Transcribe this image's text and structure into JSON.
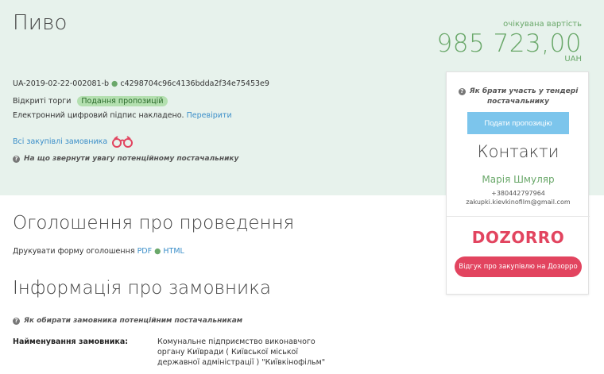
{
  "tender": {
    "title": "Пиво",
    "expected_label": "очікувана вартість",
    "price": "985 723,00",
    "currency": "UAH",
    "id": "UA-2019-02-22-002081-b",
    "hash": "c4298704c96c4136bdda2f34e75453e9",
    "procedure": "Відкриті торги",
    "status_badge": "Подання пропозицій",
    "signature_text": "Електронний цифровий підпис накладено.",
    "verify_link": "Перевірити",
    "all_purchases_link": "Всі закупівлі замовника",
    "attention_hint": "На що звернути увагу потенційному постачальнику"
  },
  "panel": {
    "participate_hint": "Як брати участь у тендері постачальнику",
    "submit_button": "Подати пропозицію",
    "contacts_title": "Контакти",
    "contact_name": "Марія Шмуляр",
    "contact_phone": "+380442797964",
    "contact_email": "zakupki.kievkinofilm@gmail.com",
    "dozorro_logo": "DOZORRO",
    "dozorro_button": "Відгук про закупівлю на Дозорро"
  },
  "announcement": {
    "heading": "Оголошення про проведення",
    "print_text": "Друкувати форму оголошення",
    "pdf_link": "PDF",
    "html_link": "HTML"
  },
  "customer": {
    "heading": "Інформація про замовника",
    "hint": "Як обирати замовника потенційним постачальникам",
    "name_label": "Найменування замовника:",
    "name_value": "Комунальне підприємство виконавчого органу Київради ( Київської міської державної адміністрації ) \"Київкінофільм\""
  },
  "colors": {
    "accent_green": "#6aa86a",
    "link_blue": "#3c8fc9",
    "dozorro_red": "#e2445f",
    "submit_blue": "#7cc5ec"
  }
}
